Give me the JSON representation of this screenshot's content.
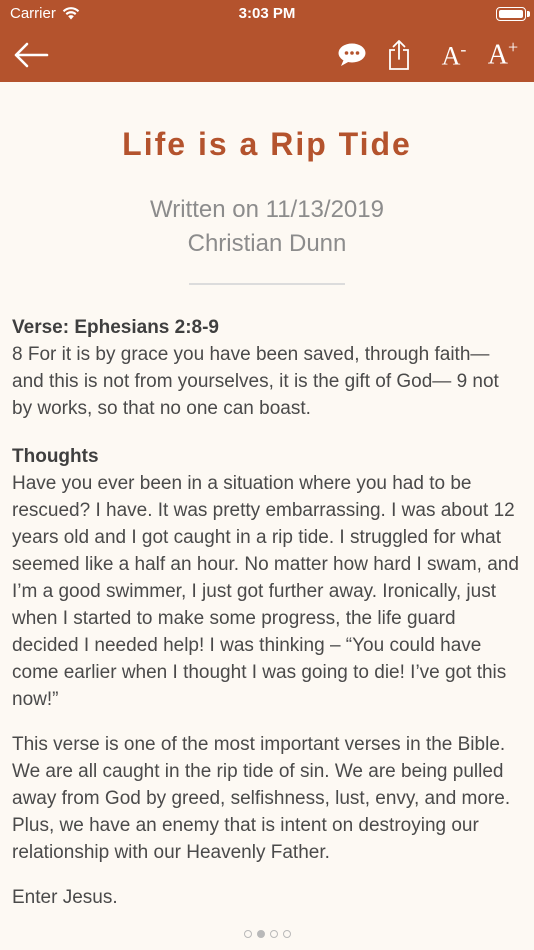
{
  "status_bar": {
    "carrier": "Carrier",
    "time": "3:03 PM"
  },
  "nav": {
    "back_icon": "arrow-left-icon",
    "comment_icon": "speech-bubble-icon",
    "share_icon": "share-icon",
    "font_smaller_label": "A",
    "font_smaller_mark": "-",
    "font_larger_label": "A",
    "font_larger_mark": "+",
    "color": "#b4532d"
  },
  "article": {
    "title": "Life is a Rip Tide",
    "written_on": "Written on 11/13/2019",
    "author": "Christian Dunn",
    "verse_heading": "Verse: Ephesians 2:8-9",
    "verse_text": "8 For it is by grace you have been saved, through faith— and this is not from yourselves, it is the gift of God— 9 not by works, so that no one can boast.",
    "thoughts_heading": "Thoughts",
    "thoughts_p1": "Have you ever been in a situation where you had to be rescued? I have. It was pretty embarrassing. I was about 12 years old and I got caught in a rip tide. I struggled for what seemed like a half an hour. No matter how hard I swam, and I’m a good swimmer, I just got further away. Ironically, just when I started to make some progress, the life guard decided I needed help! I was thinking – “You could have come earlier when I thought I was going to die! I’ve got this now!”",
    "thoughts_p2": "This verse is one of the most important verses in the Bible. We are all caught in the rip tide of sin. We are being pulled away from God by greed, selfishness, lust, envy, and more. Plus, we have an enemy that is intent on destroying our relationship with our Heavenly Father.",
    "thoughts_p3": "Enter Jesus."
  },
  "pager": {
    "pages": 4,
    "current": 2
  }
}
